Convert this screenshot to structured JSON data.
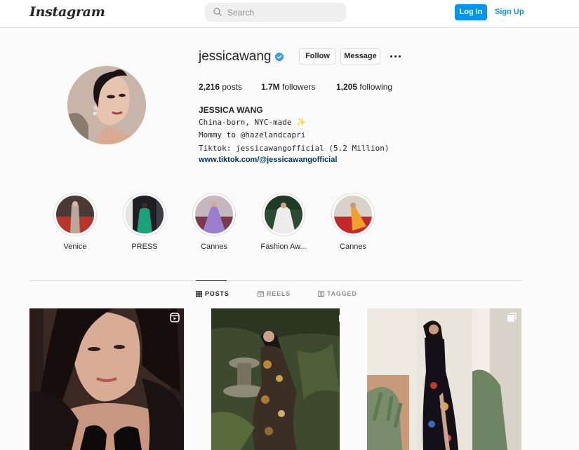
{
  "header": {
    "logo": "Instagram",
    "search_placeholder": "Search",
    "login_label": "Log In",
    "signup_label": "Sign Up",
    "accent": "#0095f6"
  },
  "profile": {
    "username": "jessicawang",
    "verified": true,
    "follow_label": "Follow",
    "message_label": "Message",
    "more_icon": "more-horizontal-icon",
    "stats": {
      "posts_count": "2,216",
      "posts_label": "posts",
      "followers_count": "1.7M",
      "followers_label": "followers",
      "following_count": "1,205",
      "following_label": "following"
    },
    "full_name": "JESSICA WANG",
    "bio": [
      "China-born, NYC-made ✨",
      "Mommy to @hazelandcapri",
      "Tiktok: jessicawangofficial (5.2 Million)"
    ],
    "link": "www.tiktok.com/@jessicawangofficial"
  },
  "highlights": [
    {
      "label": "Venice"
    },
    {
      "label": "PRESS"
    },
    {
      "label": "Cannes"
    },
    {
      "label": "Fashion Aw..."
    },
    {
      "label": "Cannes"
    }
  ],
  "tabs": [
    {
      "label": "POSTS",
      "icon": "grid-icon",
      "active": true
    },
    {
      "label": "REELS",
      "icon": "reels-icon",
      "active": false
    },
    {
      "label": "TAGGED",
      "icon": "tagged-icon",
      "active": false
    }
  ],
  "posts": [
    {
      "type": "reel"
    },
    {
      "type": "carousel"
    },
    {
      "type": "carousel"
    }
  ]
}
